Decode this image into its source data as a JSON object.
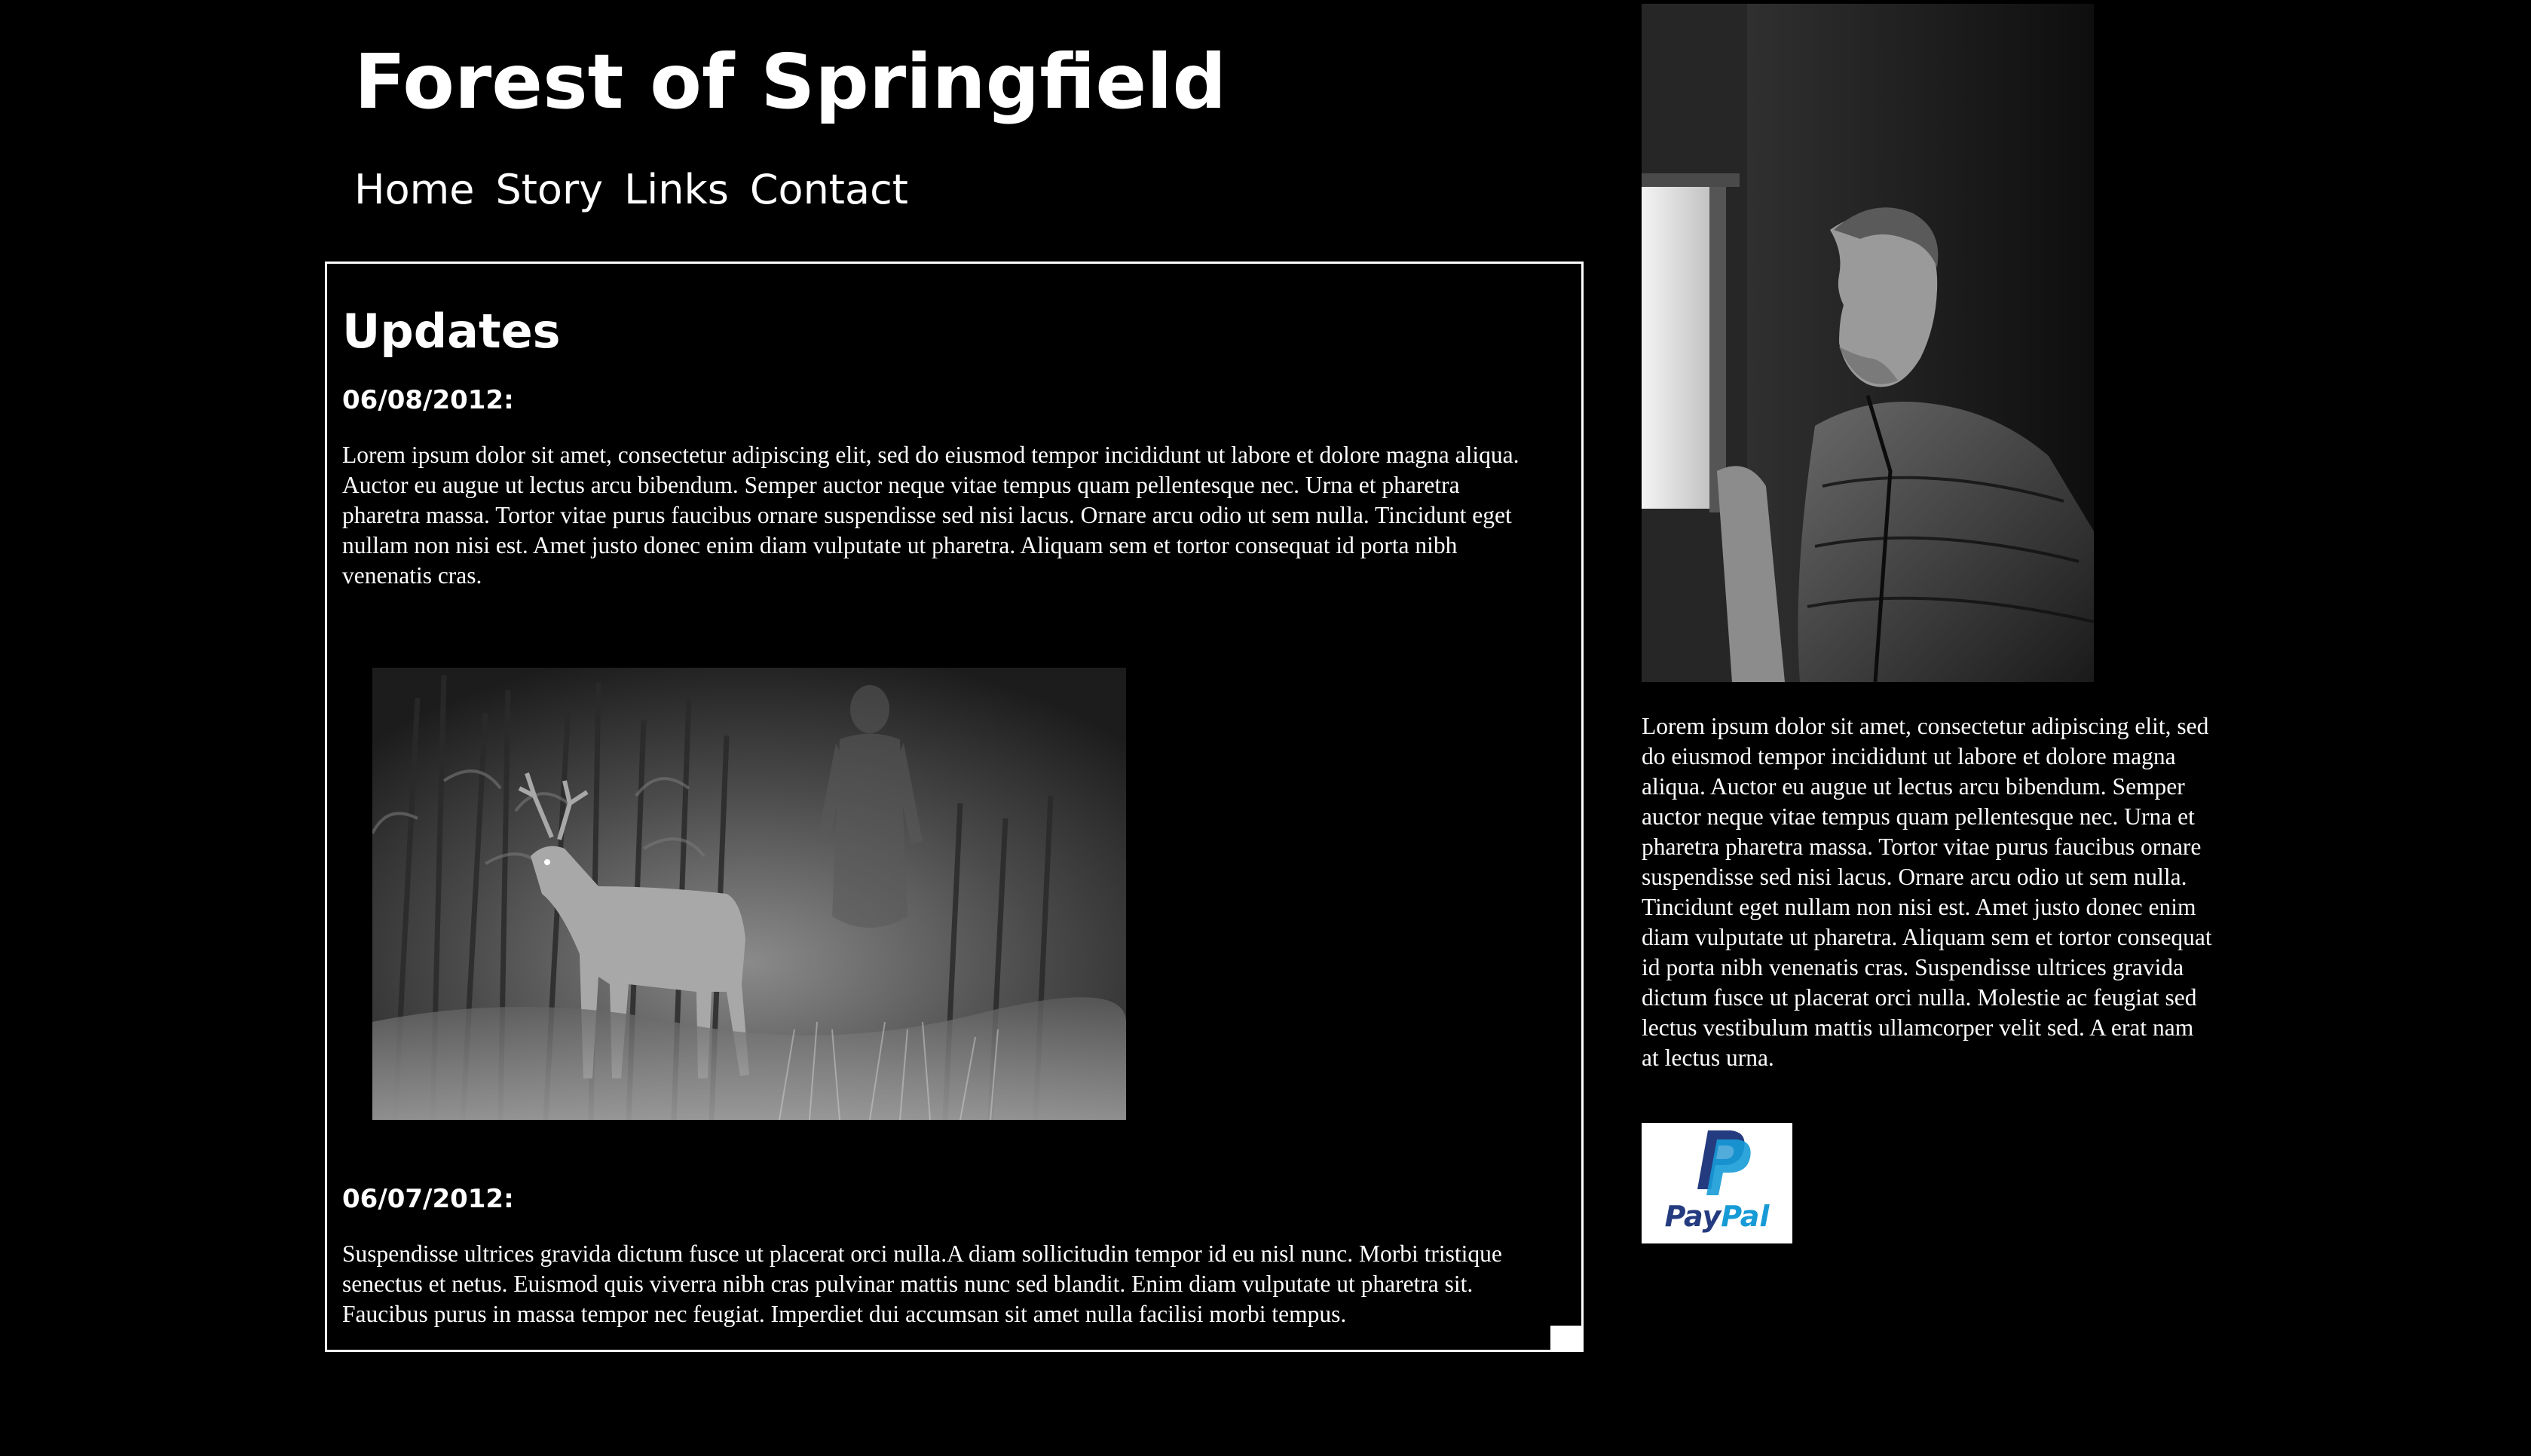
{
  "site": {
    "title": "Forest of Springfield"
  },
  "nav": {
    "items": [
      "Home",
      "Story",
      "Links",
      "Contact"
    ]
  },
  "updates": {
    "heading": "Updates",
    "entries": [
      {
        "date": "06/08/2012:",
        "text": "Lorem ipsum dolor sit amet, consectetur adipiscing elit, sed do eiusmod tempor incididunt ut labore et dolore magna aliqua. Auctor eu augue ut lectus arcu bibendum. Semper auctor neque vitae tempus quam pellentesque nec. Urna et pharetra pharetra massa. Tortor vitae purus faucibus ornare suspendisse sed nisi lacus. Ornare arcu odio ut sem nulla. Tincidunt eget nullam non nisi est. Amet justo donec enim diam vulputate ut pharetra. Aliquam sem et tortor consequat id porta nibh venenatis cras."
      },
      {
        "date": "06/07/2012:",
        "text": "Suspendisse ultrices gravida dictum fusce ut placerat orci nulla.A diam sollicitudin tempor id eu nisl nunc. Morbi tristique senectus et netus. Euismod quis viverra nibh cras pulvinar mattis nunc sed blandit. Enim diam vulputate ut pharetra sit. Faucibus purus in massa tempor nec feugiat. Imperdiet dui accumsan sit amet nulla facilisi morbi tempus."
      }
    ]
  },
  "sidebar": {
    "text": "Lorem ipsum dolor sit amet, consectetur adipiscing elit, sed do eiusmod tempor incididunt ut labore et dolore magna aliqua. Auctor eu augue ut lectus arcu bibendum. Semper auctor neque vitae tempus quam pellentesque nec. Urna et pharetra pharetra massa. Tortor vitae purus faucibus ornare suspendisse sed nisi lacus. Ornare arcu odio ut sem nulla. Tincidunt eget nullam non nisi est. Amet justo donec enim diam vulputate ut pharetra. Aliquam sem et tortor consequat id porta nibh venenatis cras. Suspendisse ultrices gravida dictum fusce ut placerat orci nulla. Molestie ac feugiat sed lectus vestibulum mattis ullamcorper velit sed. A erat nam at lectus urna."
  },
  "paypal": {
    "word_pay": "Pay",
    "word_pal": "Pal",
    "icon": "paypal-logo-icon"
  },
  "colors": {
    "background": "#000000",
    "text": "#ffffff",
    "paypal_dark": "#253b80",
    "paypal_light": "#179bd7"
  }
}
